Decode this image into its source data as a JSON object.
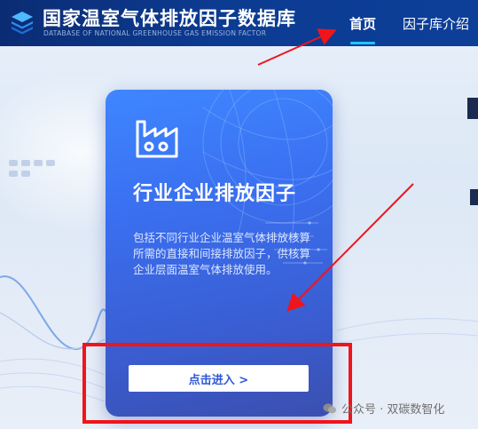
{
  "header": {
    "logo_icon": "layered-stack-icon",
    "title": "国家温室气体排放因子数据库",
    "subtitle": "DATABASE OF NATIONAL GREENHOUSE GAS EMISSION FACTOR",
    "nav": {
      "home": "首页",
      "intro": "因子库介绍"
    },
    "active_underline_color": "#20c4ff",
    "background_color": "#0c3b91"
  },
  "card": {
    "icon": "factory-icon",
    "title": "行业企业排放因子",
    "description": "包括不同行业企业温室气体排放核算所需的直接和间接排放因子，供核算企业层面温室气体排放使用。",
    "button_label": "点击进入 >",
    "gradient_top": "#3f86ff",
    "gradient_bottom": "#3b4fb0"
  },
  "annotations": {
    "arrow_color": "#f0141b",
    "box_color": "#f0141b"
  },
  "watermark": {
    "icon": "wechat-icon",
    "text": "公众号 · 双碳数智化"
  }
}
